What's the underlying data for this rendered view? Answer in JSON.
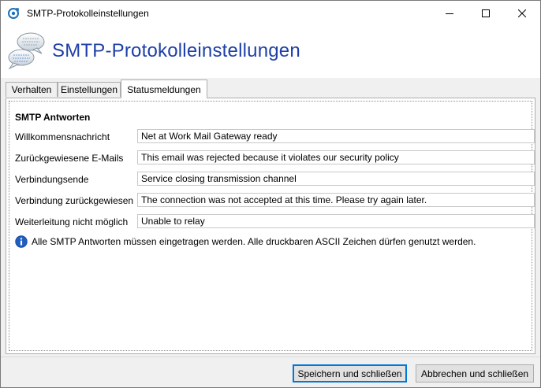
{
  "window": {
    "title": "SMTP-Protokolleinstellungen"
  },
  "header": {
    "title": "SMTP-Protokolleinstellungen",
    "icon": "chat-bubbles-icon"
  },
  "tabs": [
    {
      "label": "Verhalten",
      "active": false
    },
    {
      "label": "Einstellungen",
      "active": false
    },
    {
      "label": "Statusmeldungen",
      "active": true
    }
  ],
  "panel": {
    "heading": "SMTP Antworten",
    "rows": [
      {
        "label": "Willkommensnachricht",
        "value": "Net at Work Mail Gateway ready"
      },
      {
        "label": "Zurückgewiesene E-Mails",
        "value": "This email was rejected because it violates our security policy"
      },
      {
        "label": "Verbindungsende",
        "value": "Service closing transmission channel"
      },
      {
        "label": "Verbindung zurückgewiesen",
        "value": "The connection was not accepted at this time. Please try again later."
      },
      {
        "label": "Weiterleitung nicht möglich",
        "value": "Unable to relay"
      }
    ],
    "info": "Alle SMTP Antworten müssen eingetragen werden. Alle druckbaren ASCII Zeichen dürfen genutzt werden."
  },
  "footer": {
    "save_label": "Speichern und schließen",
    "cancel_label": "Abbrechen und schließen"
  },
  "colors": {
    "header_title": "#1e3fa8",
    "accent": "#0078d7",
    "info_icon": "#1f5fbf"
  }
}
